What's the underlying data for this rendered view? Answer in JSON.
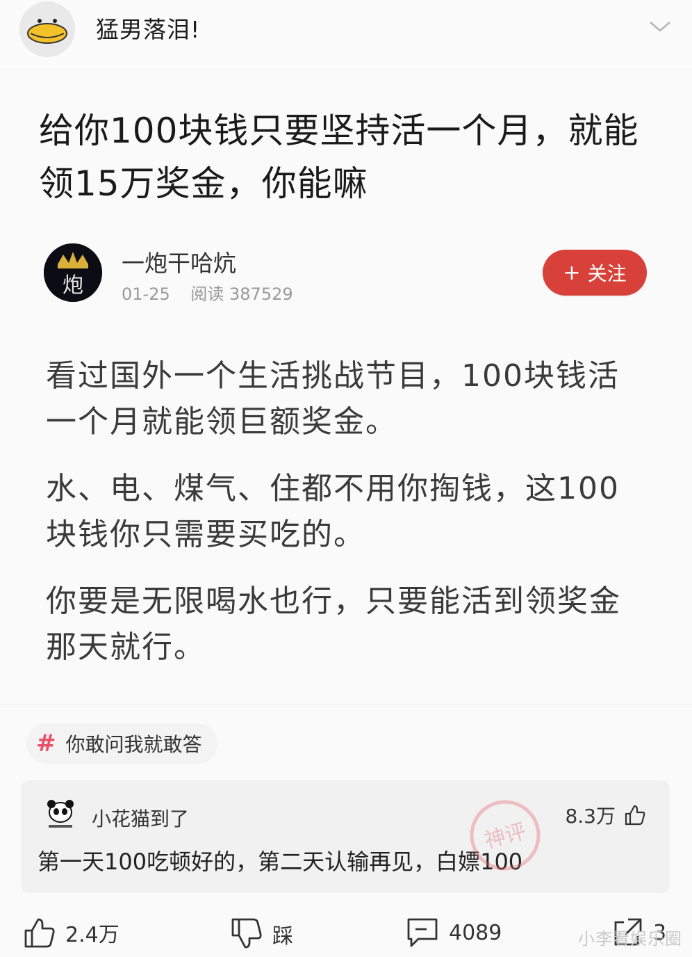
{
  "header": {
    "name": "猛男落泪!",
    "menu_icon": "chevron-down-icon"
  },
  "post": {
    "title": "给你100块钱只要坚持活一个月，就能领15万奖金，你能嘛",
    "author": {
      "name": "一炮干哈炕",
      "date": "01-25",
      "reads": "阅读 387529",
      "avatar_text": "炮"
    },
    "follow": {
      "plus": "+",
      "label": "关注"
    },
    "paragraphs": [
      "看过国外一个生活挑战节目，100块钱活一个月就能领巨额奖金。",
      "水、电、煤气、住都不用你掏钱，这100块钱你只需要买吃的。",
      "你要是无限喝水也行，只要能活到领奖金那天就行。"
    ]
  },
  "topic": {
    "hash": "#",
    "label": "你敢问我就敢答"
  },
  "comment": {
    "user": "小花猫到了",
    "likes": "8.3万",
    "text": "第一天100吃顿好的，第二天认输再见，白嫖100"
  },
  "stamp_text": "神评",
  "actions": {
    "like": "2.4万",
    "dislike": "踩",
    "comments": "4089",
    "share": "3"
  },
  "watermark": "小李看娱乐圈",
  "colors": {
    "accent": "#d8403a",
    "topic_hash": "#e8506a"
  }
}
